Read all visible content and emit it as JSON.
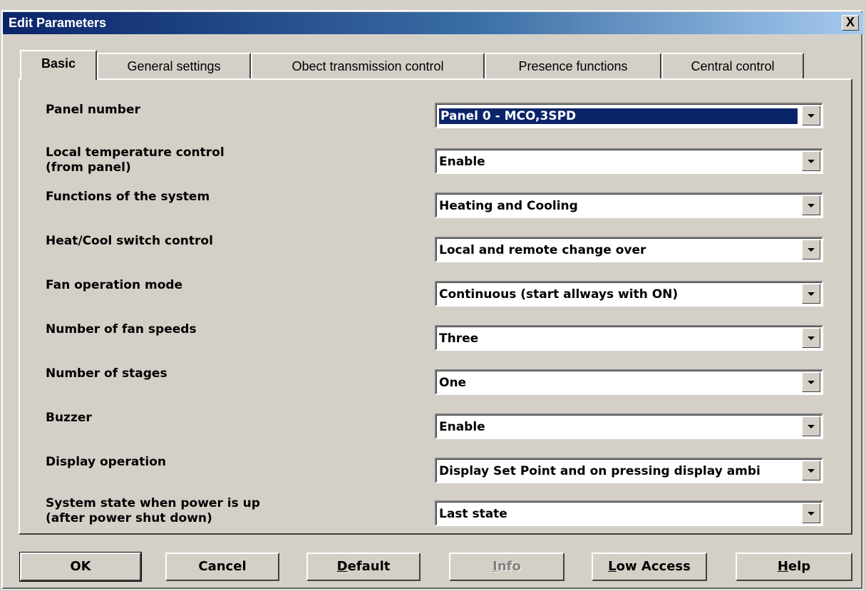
{
  "window": {
    "title": "Edit Parameters",
    "close_label": "X"
  },
  "tabs": [
    {
      "label": "Basic",
      "active": true
    },
    {
      "label": "General settings",
      "active": false
    },
    {
      "label": "Obect transmission control",
      "active": false
    },
    {
      "label": "Presence functions",
      "active": false
    },
    {
      "label": "Central control",
      "active": false
    }
  ],
  "parameters": [
    {
      "label": "Panel number",
      "value": "Panel 0 - MCO,3SPD"
    },
    {
      "label": "Local temperature control\n(from panel)",
      "value": "Enable"
    },
    {
      "label": "Functions of the system",
      "value": "Heating and Cooling"
    },
    {
      "label": "Heat/Cool switch control",
      "value": "Local and remote change over"
    },
    {
      "label": "Fan operation mode",
      "value": "Continuous (start allways with ON)"
    },
    {
      "label": "Number of fan speeds",
      "value": "Three"
    },
    {
      "label": "Number of stages",
      "value": "One"
    },
    {
      "label": "Buzzer",
      "value": "Enable"
    },
    {
      "label": "Display operation",
      "value": "Display Set Point and on pressing display ambi"
    },
    {
      "label": "System state when power is up\n(after power shut down)",
      "value": "Last state"
    }
  ],
  "buttons": {
    "ok": "OK",
    "cancel": "Cancel",
    "default_first": "D",
    "default_rest": "efault",
    "info_first": "I",
    "info_rest": "nfo",
    "low_access_first": "L",
    "low_access_rest": "ow Access",
    "help_first": "H",
    "help_rest": "elp"
  },
  "colors": {
    "face": "#d4d0c8",
    "title_start": "#0a246a",
    "title_end": "#a6caf0",
    "selection": "#0a246a"
  }
}
